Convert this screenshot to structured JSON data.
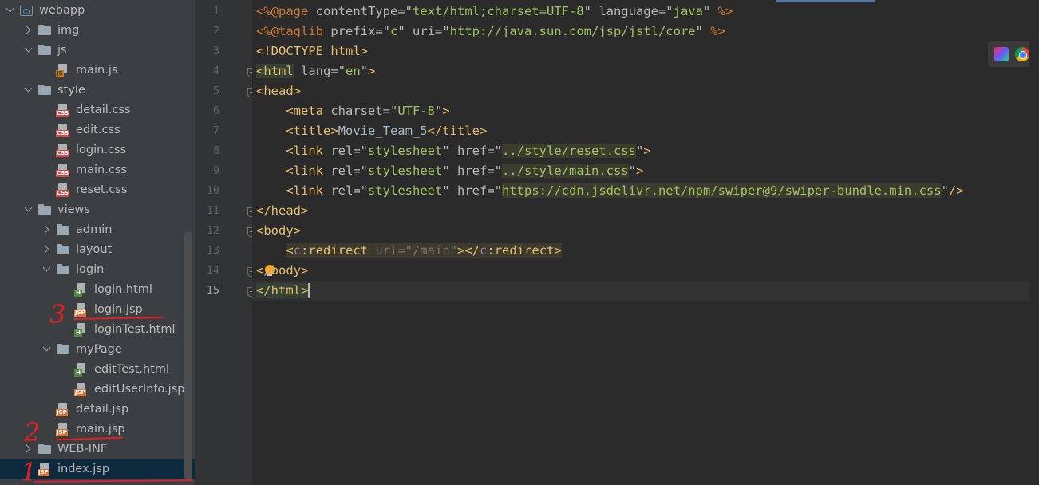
{
  "project_tree": {
    "rows": [
      {
        "label": "webapp",
        "kind": "webapp",
        "depth": 0,
        "arrow": "open",
        "icon": "webapp-folder-icon"
      },
      {
        "label": "img",
        "kind": "folder",
        "depth": 1,
        "arrow": "closed",
        "icon": "folder-icon"
      },
      {
        "label": "js",
        "kind": "folder",
        "depth": 1,
        "arrow": "open",
        "icon": "folder-icon"
      },
      {
        "label": "main.js",
        "kind": "file",
        "filetype": "JS",
        "depth": 2,
        "icon": "js-file-icon"
      },
      {
        "label": "style",
        "kind": "folder",
        "depth": 1,
        "arrow": "open",
        "icon": "folder-icon"
      },
      {
        "label": "detail.css",
        "kind": "file",
        "filetype": "CSS",
        "depth": 2,
        "icon": "css-file-icon"
      },
      {
        "label": "edit.css",
        "kind": "file",
        "filetype": "CSS",
        "depth": 2,
        "icon": "css-file-icon"
      },
      {
        "label": "login.css",
        "kind": "file",
        "filetype": "CSS",
        "depth": 2,
        "icon": "css-file-icon"
      },
      {
        "label": "main.css",
        "kind": "file",
        "filetype": "CSS",
        "depth": 2,
        "icon": "css-file-icon"
      },
      {
        "label": "reset.css",
        "kind": "file",
        "filetype": "CSS",
        "depth": 2,
        "icon": "css-file-icon"
      },
      {
        "label": "views",
        "kind": "folder",
        "depth": 1,
        "arrow": "open",
        "icon": "folder-icon"
      },
      {
        "label": "admin",
        "kind": "folder",
        "depth": 2,
        "arrow": "closed",
        "icon": "folder-icon"
      },
      {
        "label": "layout",
        "kind": "folder",
        "depth": 2,
        "arrow": "closed",
        "icon": "folder-icon"
      },
      {
        "label": "login",
        "kind": "folder",
        "depth": 2,
        "arrow": "open",
        "icon": "folder-icon"
      },
      {
        "label": "login.html",
        "kind": "file",
        "filetype": "H",
        "depth": 3,
        "icon": "html-file-icon"
      },
      {
        "label": "login.jsp",
        "kind": "file",
        "filetype": "JSP",
        "depth": 3,
        "icon": "jsp-file-icon"
      },
      {
        "label": "loginTest.html",
        "kind": "file",
        "filetype": "H",
        "depth": 3,
        "icon": "html-file-icon"
      },
      {
        "label": "myPage",
        "kind": "folder",
        "depth": 2,
        "arrow": "open",
        "icon": "folder-icon"
      },
      {
        "label": "editTest.html",
        "kind": "file",
        "filetype": "H",
        "depth": 3,
        "icon": "html-file-icon"
      },
      {
        "label": "editUserInfo.jsp",
        "kind": "file",
        "filetype": "JSP",
        "depth": 3,
        "icon": "jsp-file-icon"
      },
      {
        "label": "detail.jsp",
        "kind": "file",
        "filetype": "JSP",
        "depth": 2,
        "icon": "jsp-file-icon"
      },
      {
        "label": "main.jsp",
        "kind": "file",
        "filetype": "JSP",
        "depth": 2,
        "icon": "jsp-file-icon"
      },
      {
        "label": "WEB-INF",
        "kind": "folder",
        "depth": 1,
        "arrow": "closed",
        "icon": "folder-icon"
      },
      {
        "label": "index.jsp",
        "kind": "file",
        "filetype": "JSP",
        "depth": 1,
        "icon": "jsp-file-icon",
        "selected": true
      }
    ]
  },
  "annotations": {
    "mark_1": "1",
    "mark_2": "2",
    "mark_3": "3"
  },
  "editor": {
    "line_numbers": [
      "1",
      "2",
      "3",
      "4",
      "5",
      "6",
      "7",
      "8",
      "9",
      "10",
      "11",
      "12",
      "13",
      "14",
      "15"
    ],
    "current_line": 15,
    "lines": [
      [
        {
          "t": "<%@",
          "c": "dir"
        },
        {
          "t": "page ",
          "c": "dir"
        },
        {
          "t": "contentType",
          "c": "an"
        },
        {
          "t": "=\"",
          "c": "an"
        },
        {
          "t": "text/html;charset=UTF-8",
          "c": "av"
        },
        {
          "t": "\" ",
          "c": "an"
        },
        {
          "t": "language",
          "c": "an"
        },
        {
          "t": "=\"",
          "c": "an"
        },
        {
          "t": "java",
          "c": "av"
        },
        {
          "t": "\" ",
          "c": "an"
        },
        {
          "t": "%>",
          "c": "dir"
        }
      ],
      [
        {
          "t": "<%@",
          "c": "dir"
        },
        {
          "t": "taglib ",
          "c": "dir"
        },
        {
          "t": "prefix",
          "c": "an"
        },
        {
          "t": "=\"",
          "c": "an"
        },
        {
          "t": "c",
          "c": "av"
        },
        {
          "t": "\" ",
          "c": "an"
        },
        {
          "t": "uri",
          "c": "an"
        },
        {
          "t": "=\"",
          "c": "an"
        },
        {
          "t": "http://java.sun.com/jsp/jstl/core",
          "c": "av"
        },
        {
          "t": "\" ",
          "c": "an"
        },
        {
          "t": "%>",
          "c": "dir"
        }
      ],
      [
        {
          "t": "<!DOCTYPE html>",
          "c": "tg"
        }
      ],
      [
        {
          "t": "<html",
          "c": "tg hl"
        },
        {
          "t": " lang",
          "c": "an"
        },
        {
          "t": "=\"",
          "c": "an"
        },
        {
          "t": "en",
          "c": "av"
        },
        {
          "t": "\"",
          "c": "an"
        },
        {
          "t": ">",
          "c": "tg"
        }
      ],
      [
        {
          "t": "<head>",
          "c": "tg"
        }
      ],
      [
        {
          "t": "    ",
          "c": ""
        },
        {
          "t": "<meta",
          "c": "tg"
        },
        {
          "t": " charset",
          "c": "an"
        },
        {
          "t": "=\"",
          "c": "an"
        },
        {
          "t": "UTF-8",
          "c": "av"
        },
        {
          "t": "\"",
          "c": "an"
        },
        {
          "t": ">",
          "c": "tg"
        }
      ],
      [
        {
          "t": "    ",
          "c": ""
        },
        {
          "t": "<title>",
          "c": "tg"
        },
        {
          "t": "Movie_Team_5",
          "c": ""
        },
        {
          "t": "</title>",
          "c": "tg"
        }
      ],
      [
        {
          "t": "    ",
          "c": ""
        },
        {
          "t": "<link",
          "c": "tg"
        },
        {
          "t": " rel",
          "c": "an"
        },
        {
          "t": "=\"",
          "c": "an"
        },
        {
          "t": "stylesheet",
          "c": "av"
        },
        {
          "t": "\" ",
          "c": "an"
        },
        {
          "t": "href",
          "c": "an"
        },
        {
          "t": "=\"",
          "c": "an"
        },
        {
          "t": "../style/reset.css",
          "c": "url"
        },
        {
          "t": "\"",
          "c": "an"
        },
        {
          "t": ">",
          "c": "tg"
        }
      ],
      [
        {
          "t": "    ",
          "c": ""
        },
        {
          "t": "<link",
          "c": "tg"
        },
        {
          "t": " rel",
          "c": "an"
        },
        {
          "t": "=\"",
          "c": "an"
        },
        {
          "t": "stylesheet",
          "c": "av"
        },
        {
          "t": "\" ",
          "c": "an"
        },
        {
          "t": "href",
          "c": "an"
        },
        {
          "t": "=\"",
          "c": "an"
        },
        {
          "t": "../style/main.css",
          "c": "url"
        },
        {
          "t": "\"",
          "c": "an"
        },
        {
          "t": ">",
          "c": "tg"
        }
      ],
      [
        {
          "t": "    ",
          "c": ""
        },
        {
          "t": "<link",
          "c": "tg"
        },
        {
          "t": " rel",
          "c": "an"
        },
        {
          "t": "=\"",
          "c": "an"
        },
        {
          "t": "stylesheet",
          "c": "av"
        },
        {
          "t": "\" ",
          "c": "an"
        },
        {
          "t": "href",
          "c": "an"
        },
        {
          "t": "=\"",
          "c": "an"
        },
        {
          "t": "https://cdn.jsdelivr.net/npm/swiper@9/swiper-bundle.min.css",
          "c": "url"
        },
        {
          "t": "\"",
          "c": "an"
        },
        {
          "t": "/>",
          "c": "tg"
        }
      ],
      [
        {
          "t": "</head>",
          "c": "tg"
        }
      ],
      [
        {
          "t": "<body>",
          "c": "tg"
        }
      ],
      [
        {
          "t": "    ",
          "c": ""
        },
        {
          "t": "<",
          "c": "tg amber"
        },
        {
          "t": "c",
          "c": "ns amber"
        },
        {
          "t": ":redirect ",
          "c": "tg amber"
        },
        {
          "t": "url",
          "c": "dull amber"
        },
        {
          "t": "=\"",
          "c": "dull amber"
        },
        {
          "t": "/main",
          "c": "dull amber"
        },
        {
          "t": "\"",
          "c": "dull amber"
        },
        {
          "t": "></",
          "c": "tg amber"
        },
        {
          "t": "c",
          "c": "ns amber"
        },
        {
          "t": ":redirect",
          "c": "tg amber"
        },
        {
          "t": ">",
          "c": "tg amber"
        }
      ],
      [
        {
          "t": "</body>",
          "c": "tg"
        }
      ],
      [
        {
          "t": "</html>",
          "c": "tg hl"
        }
      ]
    ]
  },
  "toolbar": {
    "browser_icons": [
      "intellij-icon",
      "chrome-icon"
    ]
  }
}
